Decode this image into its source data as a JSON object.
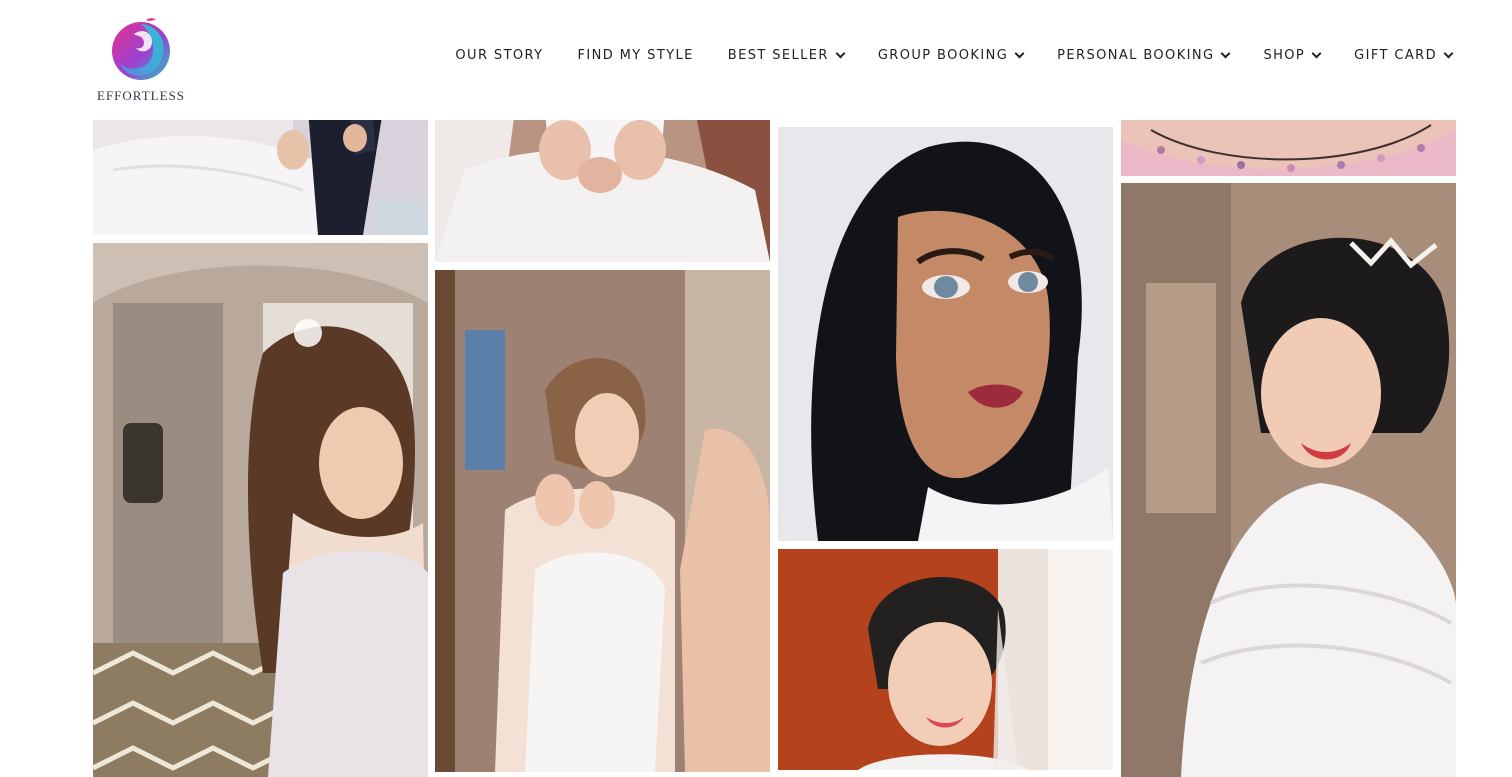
{
  "brand": {
    "name": "EFFORTLESS",
    "colors": {
      "pink": "#e6308f",
      "teal": "#1fc8c8",
      "purple": "#7a3cc8"
    }
  },
  "nav": {
    "items": [
      {
        "label": "OUR STORY",
        "dropdown": false
      },
      {
        "label": "FIND MY STYLE",
        "dropdown": false
      },
      {
        "label": "BEST SELLER",
        "dropdown": true
      },
      {
        "label": "GROUP BOOKING",
        "dropdown": true
      },
      {
        "label": "PERSONAL BOOKING",
        "dropdown": true
      },
      {
        "label": "SHOP",
        "dropdown": true
      },
      {
        "label": "GIFT CARD",
        "dropdown": true
      }
    ]
  },
  "gallery": {
    "photos": [
      {
        "subject": "bride-and-groom-gown-detail"
      },
      {
        "subject": "bride-gown-hands-detail"
      },
      {
        "subject": "beaded-neckline-detail"
      },
      {
        "subject": "bride-long-wavy-hair-profile"
      },
      {
        "subject": "bride-earring-mirror"
      },
      {
        "subject": "portrait-bold-makeup"
      },
      {
        "subject": "bride-updo-smiling"
      },
      {
        "subject": "bride-lace-gown-smiling"
      }
    ]
  }
}
